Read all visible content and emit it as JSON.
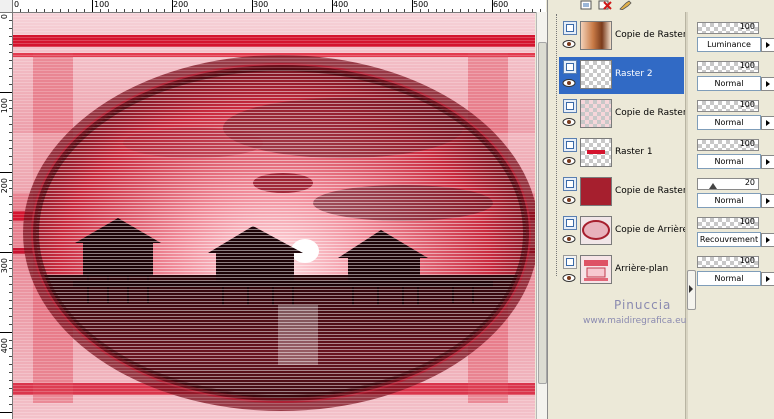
{
  "ruler": {
    "top_labels": [
      "0",
      "100",
      "200",
      "300",
      "400",
      "500",
      "600"
    ],
    "left_labels": [
      "0",
      "100",
      "200",
      "300",
      "400"
    ]
  },
  "toolbar": {
    "icons": [
      "layer-new-icon",
      "delete-layer-icon",
      "edit-brush-icon"
    ]
  },
  "layers": [
    {
      "name": "Copie de Raster",
      "thumb": "photo",
      "selected": false,
      "opacity": "100",
      "blend": "Luminance"
    },
    {
      "name": "Raster 2",
      "thumb": "checker",
      "selected": true,
      "opacity": "100",
      "blend": "Normal"
    },
    {
      "name": "Copie de Raster",
      "thumb": "checker-pink",
      "selected": false,
      "opacity": "100",
      "blend": "Normal"
    },
    {
      "name": "Raster 1",
      "thumb": "checker-red",
      "selected": false,
      "opacity": "100",
      "blend": "Normal"
    },
    {
      "name": "Copie de Raster",
      "thumb": "solid-red",
      "selected": false,
      "opacity": "20",
      "blend": "Normal"
    },
    {
      "name": "Copie de Arrière",
      "thumb": "ellipse",
      "selected": false,
      "opacity": "100",
      "blend": "Recouvrement"
    },
    {
      "name": "Arrière-plan",
      "thumb": "pattern",
      "selected": false,
      "opacity": "100",
      "blend": "Normal"
    }
  ],
  "watermark": {
    "title": "Pinuccia",
    "url": "www.maidiregrafica.eu"
  },
  "colors": {
    "selection": "#316ac5",
    "accent_red": "#c8102e",
    "palette_bg": "#ece9d8"
  }
}
